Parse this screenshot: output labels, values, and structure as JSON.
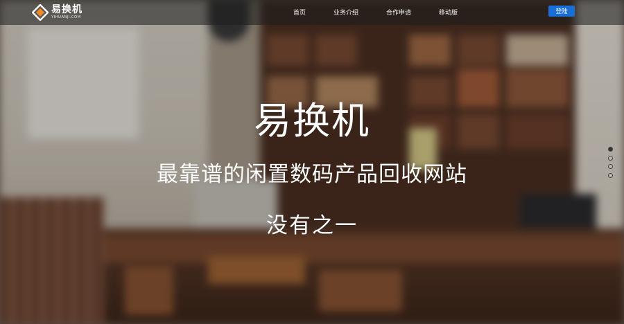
{
  "brand": {
    "name": "易换机",
    "domain": "YIHUANJI.COM",
    "logo_icon": "yihuanji-logo-icon"
  },
  "nav": {
    "items": [
      {
        "label": "首页"
      },
      {
        "label": "业务介绍"
      },
      {
        "label": "合作申请"
      },
      {
        "label": "移动版"
      }
    ],
    "login_label": "登陆"
  },
  "hero": {
    "title": "易换机",
    "subtitle": "最靠谱的闲置数码产品回收网站",
    "tagline": "没有之一"
  },
  "slider": {
    "total": 4,
    "active_index": 0
  },
  "colors": {
    "login_button": "#1a6fd6",
    "navbar": "rgba(30,30,30,0.55)",
    "logo_orange": "#f08a24"
  }
}
